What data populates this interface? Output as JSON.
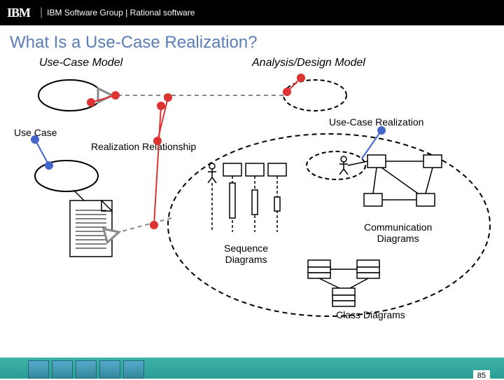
{
  "header": {
    "logo": "IBM",
    "group_text": "IBM Software Group | Rational software"
  },
  "title": "What Is a Use-Case Realization?",
  "labels": {
    "use_case_model": "Use-Case Model",
    "analysis_design_model": "Analysis/Design Model",
    "use_case": "Use Case",
    "use_case_realization": "Use-Case Realization",
    "realization_relationship": "Realization Relationship",
    "sequence_diagrams": "Sequence\nDiagrams",
    "communication_diagrams": "Communication\nDiagrams",
    "class_diagrams": "Class Diagrams"
  },
  "page_number": "85"
}
